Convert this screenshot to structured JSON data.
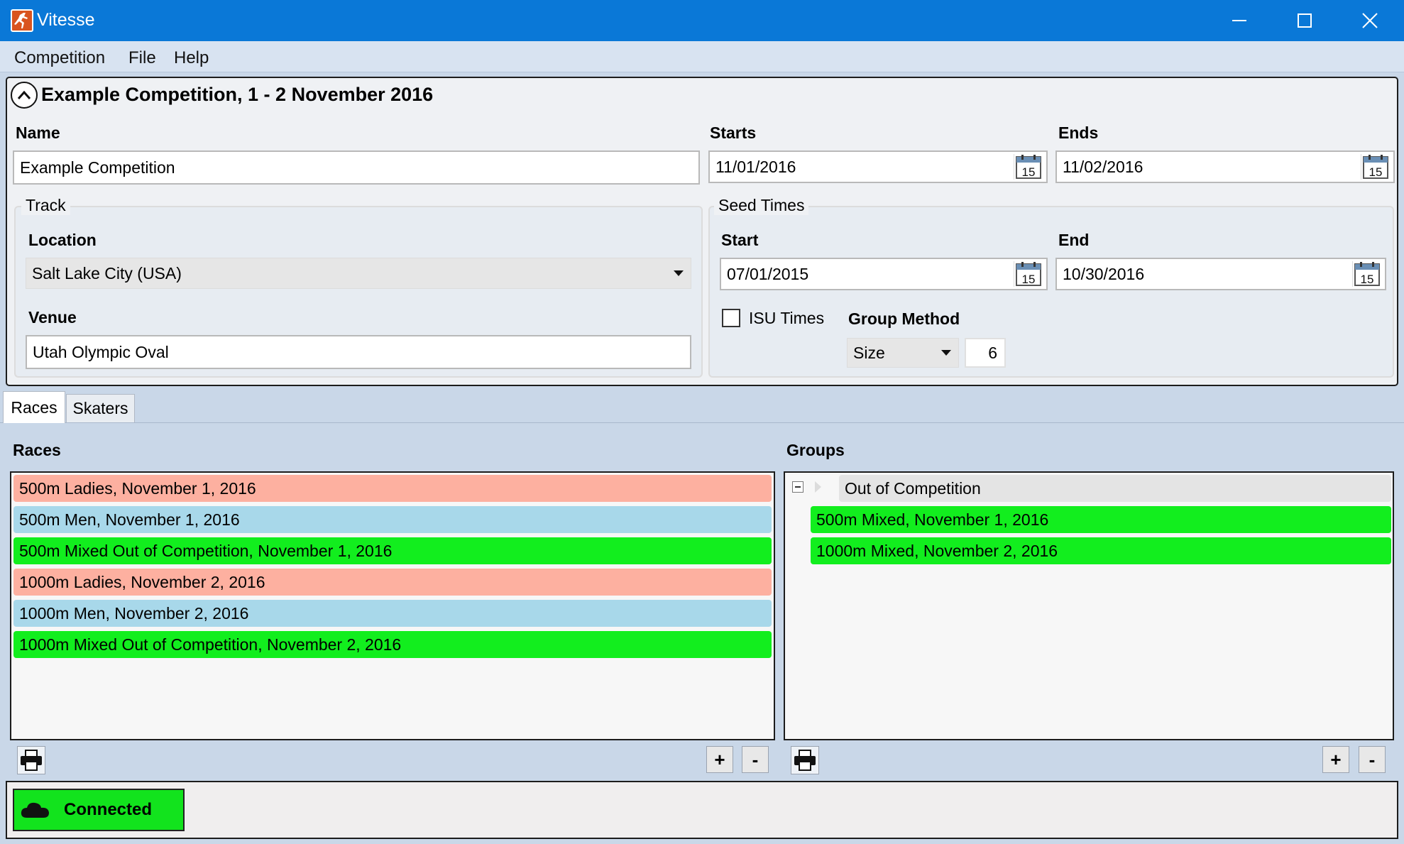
{
  "window": {
    "title": "Vitesse"
  },
  "menu": [
    "Competition",
    "File",
    "Help"
  ],
  "competition": {
    "heading": "Example Competition, 1 - 2 November 2016",
    "name_label": "Name",
    "name_value": "Example Competition",
    "starts_label": "Starts",
    "starts_value": "11/01/2016",
    "ends_label": "Ends",
    "ends_value": "11/02/2016",
    "calendar_day": "15",
    "track": {
      "title": "Track",
      "location_label": "Location",
      "location_value": "Salt Lake City (USA)",
      "venue_label": "Venue",
      "venue_value": "Utah Olympic Oval"
    },
    "seed_times": {
      "title": "Seed Times",
      "start_label": "Start",
      "start_value": "07/01/2015",
      "end_label": "End",
      "end_value": "10/30/2016",
      "isu_label": "ISU Times",
      "group_method_label": "Group Method",
      "group_method_value": "Size",
      "group_size_value": "6"
    }
  },
  "tabs": [
    "Races",
    "Skaters"
  ],
  "races": {
    "title": "Races",
    "items": [
      {
        "label": "500m Ladies, November 1, 2016",
        "color": "#fdb0a0"
      },
      {
        "label": "500m Men, November 1, 2016",
        "color": "#a8d8ea"
      },
      {
        "label": "500m Mixed Out of Competition, November 1, 2016",
        "color": "#12ee1e"
      },
      {
        "label": "1000m Ladies, November 2, 2016",
        "color": "#fdb0a0"
      },
      {
        "label": "1000m Men, November 2, 2016",
        "color": "#a8d8ea"
      },
      {
        "label": "1000m Mixed Out of Competition, November 2, 2016",
        "color": "#12ee1e"
      }
    ]
  },
  "groups": {
    "title": "Groups",
    "group_name": "Out of Competition",
    "items": [
      {
        "label": "500m Mixed, November 1, 2016",
        "color": "#12ee1e"
      },
      {
        "label": "1000m Mixed, November 2, 2016",
        "color": "#12ee1e"
      }
    ]
  },
  "buttons": {
    "add": "+",
    "remove": "-"
  },
  "status": {
    "connected_label": "Connected",
    "color": "#12e31d"
  }
}
